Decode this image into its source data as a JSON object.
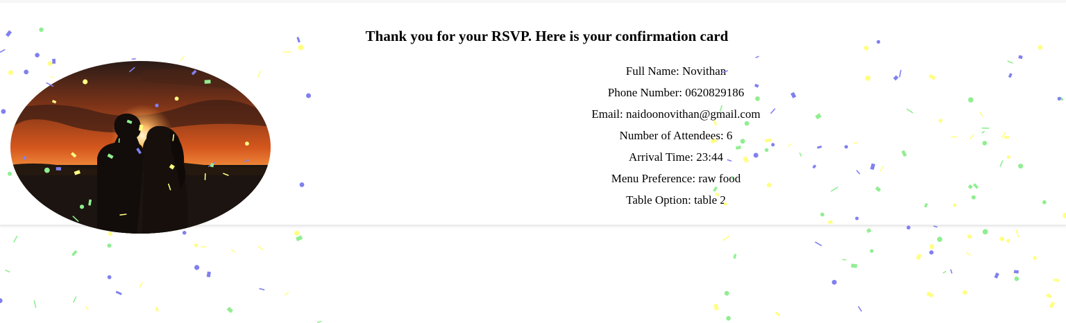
{
  "heading": "Thank you for your RSVP. Here is your confirmation card",
  "rsvp": {
    "full_name": "Full Name: Novithan",
    "phone": "Phone Number: 0620829186",
    "email": "Email: naidoonovithan@gmail.com",
    "attendees": "Number of Attendees: 6",
    "arrival": "Arrival Time: 23:44",
    "menu": "Menu Preference: raw food",
    "table": "Table Option: table 2"
  },
  "colors": {
    "confetti": [
      "#8080f0",
      "#90ee90",
      "#ffff80"
    ],
    "sky": "#d8551f",
    "silhouette": "#1a1310"
  },
  "image": {
    "subject": "couple-silhouette-at-sunset"
  }
}
